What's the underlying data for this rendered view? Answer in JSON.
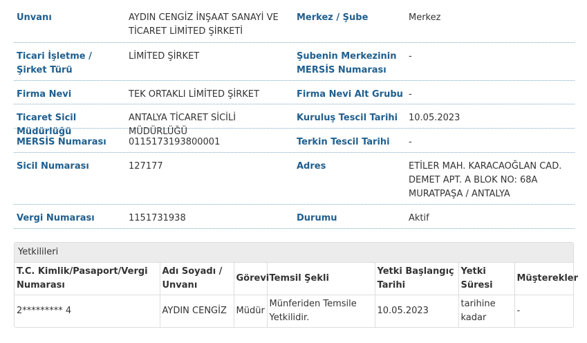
{
  "company_info": {
    "rows": [
      {
        "label1": "Unvanı",
        "value1": "AYDIN CENGİZ İNŞAAT SANAYİ VE TİCARET LİMİTED ŞİRKETİ",
        "label2": "Merkez / Şube",
        "value2": "Merkez"
      },
      {
        "label1": "Ticari İşletme / Şirket Türü",
        "value1": "LİMİTED ŞİRKET",
        "label2": "Şubenin Merkezinin MERSİS Numarası",
        "value2": "-"
      },
      {
        "label1": "Firma Nevi",
        "value1": "TEK ORTAKLI LİMİTED ŞİRKET",
        "label2": "Firma Nevi Alt Grubu",
        "value2": "-"
      },
      {
        "label1": "Ticaret Sicil Müdürlüğü",
        "value1": "ANTALYA TİCARET SİCİLİ MÜDÜRLÜĞÜ",
        "label2": "Kuruluş Tescil Tarihi",
        "value2": "10.05.2023"
      },
      {
        "label1": "MERSİS Numarası",
        "value1": "0115173193800001",
        "label2": "Terkin Tescil Tarihi",
        "value2": "-"
      },
      {
        "label1": "Sicil Numarası",
        "value1": "127177",
        "label2": "Adres",
        "value2": "ETİLER MAH. KARACAOĞLAN CAD. DEMET APT. A BLOK NO: 68A MURATPAŞA / ANTALYA"
      },
      {
        "label1": "Vergi Numarası",
        "value1": "1151731938",
        "label2": "Durumu",
        "value2": "Aktif"
      }
    ]
  },
  "authorized": {
    "title": "Yetkilileri",
    "columns": [
      "T.C. Kimlik/Pasaport/Vergi Numarası",
      "Adı Soyadı / Unvanı",
      "Görevi",
      "Temsil Şekli",
      "Yetki Başlangıç Tarihi",
      "Yetki Süresi",
      "Müşterekler"
    ],
    "rows": [
      [
        "2********* 4",
        "AYDIN CENGİZ",
        "Müdür",
        "Münferiden Temsile Yetkilidir.",
        "10.05.2023",
        "tarihine kadar",
        "-"
      ]
    ]
  }
}
